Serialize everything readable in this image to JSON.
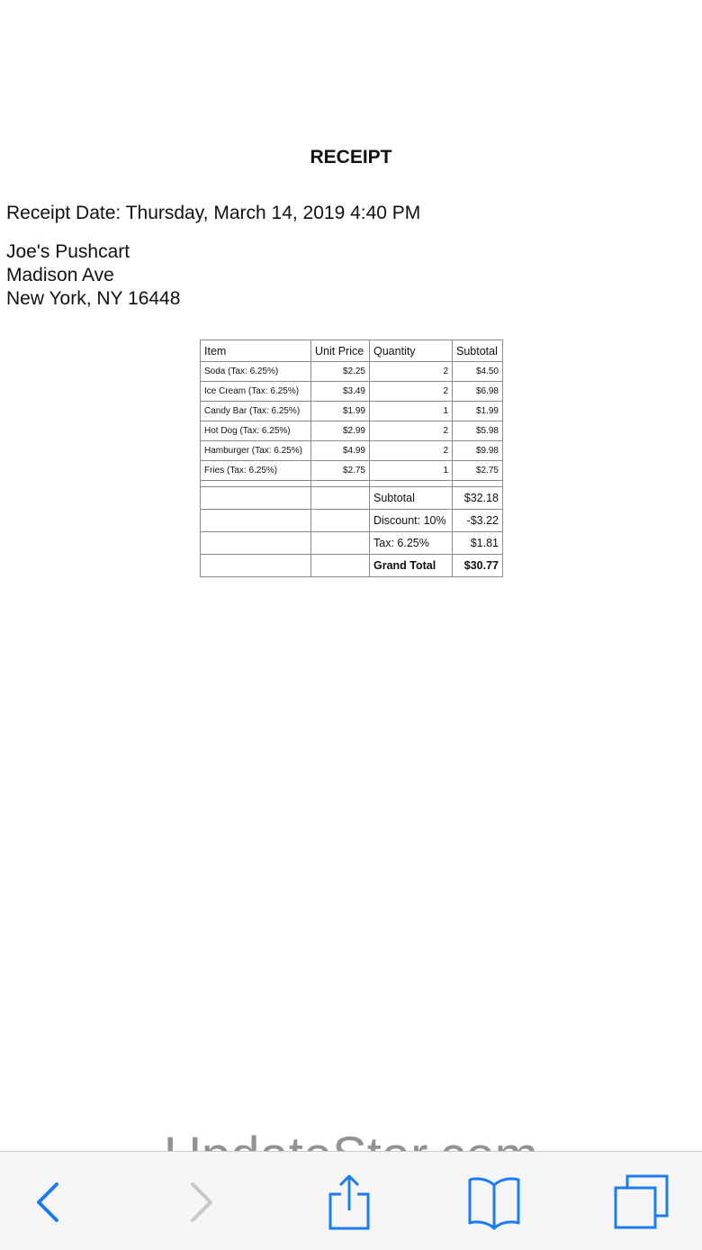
{
  "document": {
    "title": "RECEIPT",
    "receipt_date": "Receipt Date: Thursday, March 14, 2019 4:40 PM",
    "merchant": {
      "name": "Joe's Pushcart",
      "street": "Madison Ave",
      "city_line": "New York, NY 16448"
    }
  },
  "table": {
    "headers": {
      "item": "Item",
      "unit_price": "Unit Price",
      "quantity": "Quantity",
      "subtotal": "Subtotal"
    },
    "rows": [
      {
        "item": "Soda (Tax: 6.25%)",
        "unit_price": "$2.25",
        "quantity": "2",
        "subtotal": "$4.50"
      },
      {
        "item": "Ice Cream (Tax: 6.25%)",
        "unit_price": "$3.49",
        "quantity": "2",
        "subtotal": "$6.98"
      },
      {
        "item": "Candy Bar (Tax: 6.25%)",
        "unit_price": "$1.99",
        "quantity": "1",
        "subtotal": "$1.99"
      },
      {
        "item": "Hot Dog (Tax: 6.25%)",
        "unit_price": "$2.99",
        "quantity": "2",
        "subtotal": "$5.98"
      },
      {
        "item": "Hamburger (Tax: 6.25%)",
        "unit_price": "$4.99",
        "quantity": "2",
        "subtotal": "$9.98"
      },
      {
        "item": "Fries (Tax: 6.25%)",
        "unit_price": "$2.75",
        "quantity": "1",
        "subtotal": "$2.75"
      }
    ],
    "totals": [
      {
        "label": "Subtotal",
        "value": "$32.18"
      },
      {
        "label": "Discount: 10%",
        "value": "-$3.22"
      },
      {
        "label": "Tax: 6.25%",
        "value": "$1.81"
      },
      {
        "label": "Grand Total",
        "value": "$30.77"
      }
    ]
  },
  "toolbar": {
    "icons": [
      "back-icon",
      "forward-icon",
      "share-icon",
      "bookmarks-icon",
      "tabs-icon"
    ],
    "accent_color": "#1a7cf4",
    "disabled_color": "#c7c7cc"
  },
  "watermark": "UpdateStar.com"
}
